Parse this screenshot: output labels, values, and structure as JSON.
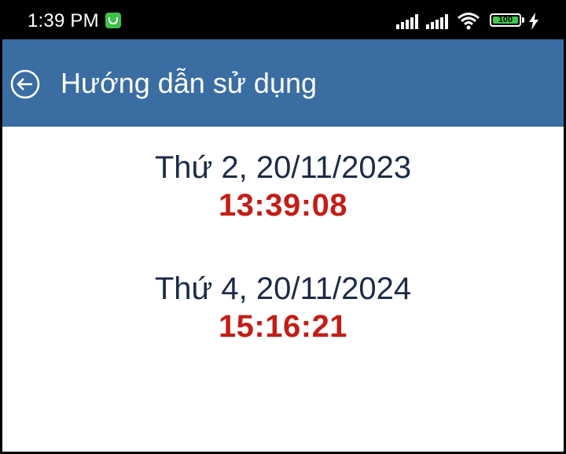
{
  "status_bar": {
    "time": "1:39 PM",
    "battery_level": "100",
    "notification_icon": "green-app-icon",
    "icons": [
      "signal-icon",
      "signal-icon",
      "wifi-icon",
      "battery-icon",
      "charging-icon"
    ]
  },
  "app_bar": {
    "title": "Hướng dẫn sử dụng",
    "back_icon": "arrow-left-circle-icon",
    "background_color": "#3a6da2"
  },
  "entries": [
    {
      "date": "Thứ 2, 20/11/2023",
      "time": "13:39:08"
    },
    {
      "date": "Thứ 4, 20/11/2024",
      "time": "15:16:21"
    }
  ],
  "colors": {
    "date_text": "#1d2b45",
    "time_text": "#c21e17"
  }
}
